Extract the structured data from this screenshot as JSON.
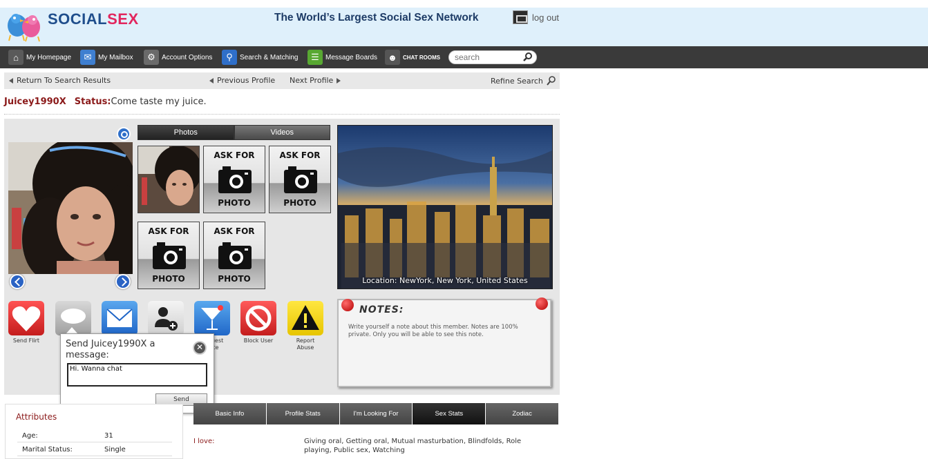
{
  "header": {
    "logo_part1": "SOCIAL",
    "logo_part2": "SEX",
    "tagline": "The World’s Largest Social Sex Network",
    "logout_label": "log out"
  },
  "nav": {
    "items": [
      {
        "label": "My Homepage",
        "icon": "home-icon"
      },
      {
        "label": "My Mailbox",
        "icon": "mailbox-icon"
      },
      {
        "label": "Account Options",
        "icon": "gears-icon"
      },
      {
        "label": "Search & Matching",
        "icon": "search-icon"
      },
      {
        "label": "Message Boards",
        "icon": "message-board-icon"
      },
      {
        "label": "CHAT ROOMS",
        "icon": "chat-icon"
      }
    ],
    "search_placeholder": "search"
  },
  "profile_nav": {
    "return": "Return To Search Results",
    "previous": "Previous Profile",
    "next": "Next Profile",
    "refine": "Refine Search"
  },
  "profile": {
    "username": "Juicey1990X",
    "status_label": "Status:",
    "status_text": "Come taste my juice."
  },
  "media_tabs": [
    "Photos",
    "Videos"
  ],
  "thumbs": {
    "ask_label": "ASK FOR",
    "photo_label": "PHOTO"
  },
  "location": "Location: NewYork, New York, United States",
  "actions": [
    {
      "label": "Send Flirt",
      "icon": "heart-icon"
    },
    {
      "label": "",
      "icon": "wink-icon"
    },
    {
      "label": "",
      "icon": "envelope-icon"
    },
    {
      "label": "",
      "icon": "add-friend-icon"
    },
    {
      "label": "Request Date",
      "icon": "cocktail-icon"
    },
    {
      "label": "Block User",
      "icon": "block-icon"
    },
    {
      "label": "Report Abuse",
      "icon": "warning-icon"
    }
  ],
  "notes": {
    "title": "NOTES:",
    "text": "Write yourself a note about this member. Notes are 100% private. Only you will be able to see this note."
  },
  "popup": {
    "title": "Send Juicey1990X a message:",
    "message_value": "Hi. Wanna chat",
    "send_label": "Send",
    "close_glyph": "✕"
  },
  "attributes": {
    "title": "Attributes",
    "rows": [
      {
        "key": "Age:",
        "value": "31"
      },
      {
        "key": "Marital Status:",
        "value": "Single"
      }
    ]
  },
  "bottom_tabs": [
    "Basic Info",
    "Profile Stats",
    "I'm Looking For",
    "Sex Stats",
    "Zodiac"
  ],
  "sex_stats": {
    "love_label": "I love:",
    "love_value": "Giving oral, Getting oral, Mutual masturbation, Blindfolds, Role playing, Public sex, Watching"
  },
  "colors": {
    "header_bg": "#dff0fb",
    "nav_bg": "#3a3a3a",
    "accent_red": "#8b1a1a",
    "logo_blue": "#1f4e8c",
    "logo_pink": "#e2265e"
  }
}
